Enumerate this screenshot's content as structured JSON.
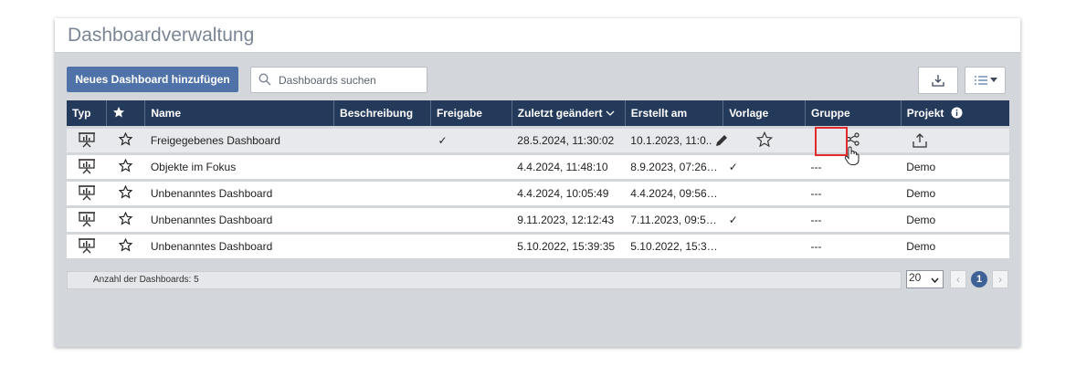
{
  "title": "Dashboardverwaltung",
  "toolbar": {
    "add_label": "Neues Dashboard hinzufügen",
    "search_placeholder": "Dashboards suchen"
  },
  "columns": {
    "typ": "Typ",
    "name": "Name",
    "beschreibung": "Beschreibung",
    "freigabe": "Freigabe",
    "zuletzt": "Zuletzt geändert",
    "erstellt": "Erstellt am",
    "vorlage": "Vorlage",
    "gruppe": "Gruppe",
    "projekt": "Projekt"
  },
  "rows": [
    {
      "name": "Freigegebenes Dashboard",
      "freigabe": "✓",
      "zuletzt": "28.5.2024, 11:30:02",
      "erstellt": "10.1.2023, 11:0..",
      "vorlage": "",
      "gruppe": "",
      "projekt": ""
    },
    {
      "name": "Objekte im Fokus",
      "freigabe": "",
      "zuletzt": "4.4.2024, 11:48:10",
      "erstellt": "8.9.2023, 07:26…",
      "vorlage": "✓",
      "gruppe": "---",
      "projekt": "Demo"
    },
    {
      "name": "Unbenanntes Dashboard",
      "freigabe": "",
      "zuletzt": "4.4.2024, 10:05:49",
      "erstellt": "4.4.2024, 09:56…",
      "vorlage": "",
      "gruppe": "---",
      "projekt": "Demo"
    },
    {
      "name": "Unbenanntes Dashboard",
      "freigabe": "",
      "zuletzt": "9.11.2023, 12:12:43",
      "erstellt": "7.11.2023, 09:5…",
      "vorlage": "✓",
      "gruppe": "---",
      "projekt": "Demo"
    },
    {
      "name": "Unbenanntes Dashboard",
      "freigabe": "",
      "zuletzt": "5.10.2022, 15:39:35",
      "erstellt": "5.10.2022, 15:3…",
      "vorlage": "",
      "gruppe": "---",
      "projekt": "Demo"
    }
  ],
  "footer": {
    "count_label": "Anzahl der Dashboards: 5",
    "page_size": "20",
    "current_page": "1"
  },
  "colors": {
    "header_bg": "#243a5a",
    "primary": "#4f73a8",
    "delete": "#e32b2b",
    "highlight_box": "#e32b2b"
  }
}
